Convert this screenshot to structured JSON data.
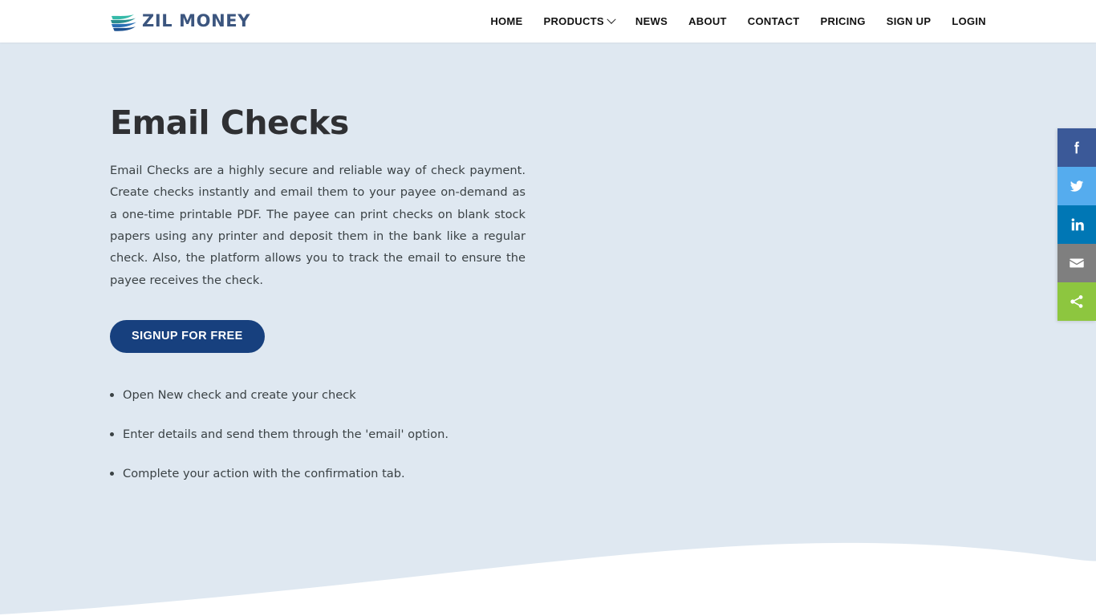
{
  "header": {
    "logo": {
      "icon": "zil-money-wing-logo",
      "text": "ZIL MONEY",
      "mark_colors": [
        "#2fb3a5",
        "#2c8f8a",
        "#1c5aa0",
        "#2a6fb5"
      ],
      "text_color": "#3c567f"
    },
    "nav": [
      {
        "label": "HOME",
        "has_dropdown": false
      },
      {
        "label": "PRODUCTS",
        "has_dropdown": true,
        "icon": "chevron-down-icon"
      },
      {
        "label": "NEWS",
        "has_dropdown": false
      },
      {
        "label": "ABOUT",
        "has_dropdown": false
      },
      {
        "label": "CONTACT",
        "has_dropdown": false
      },
      {
        "label": "PRICING",
        "has_dropdown": false
      },
      {
        "label": "SIGN UP",
        "has_dropdown": false
      },
      {
        "label": "LOGIN",
        "has_dropdown": false
      }
    ]
  },
  "hero": {
    "title": "Email Checks",
    "paragraph": "Email Checks are a highly secure and reliable way of check payment. Create checks instantly and email them to your payee on-demand as a one-time printable PDF. The payee can print checks on blank stock papers using any printer and deposit them in the bank like a regular check. Also, the platform allows you to track the email to ensure the payee receives the check.",
    "cta_label": "SIGNUP FOR FREE",
    "cta_color": "#17407e",
    "background_color": "#dfe8f1",
    "title_color": "#2f3033",
    "steps": [
      "Open New check and create your check",
      "Enter details and send them through the 'email' option.",
      "Complete your action with the confirmation tab."
    ]
  },
  "share_rail": [
    {
      "name": "facebook",
      "icon": "facebook-icon",
      "color": "#3b5998"
    },
    {
      "name": "twitter",
      "icon": "twitter-icon",
      "color": "#55acee"
    },
    {
      "name": "linkedin",
      "icon": "linkedin-icon",
      "color": "#0077b5"
    },
    {
      "name": "email",
      "icon": "envelope-icon",
      "color": "#7f7f7f"
    },
    {
      "name": "more",
      "icon": "share-nodes-icon",
      "color": "#8dc63f"
    }
  ],
  "wave": {
    "color": "#ffffff"
  }
}
